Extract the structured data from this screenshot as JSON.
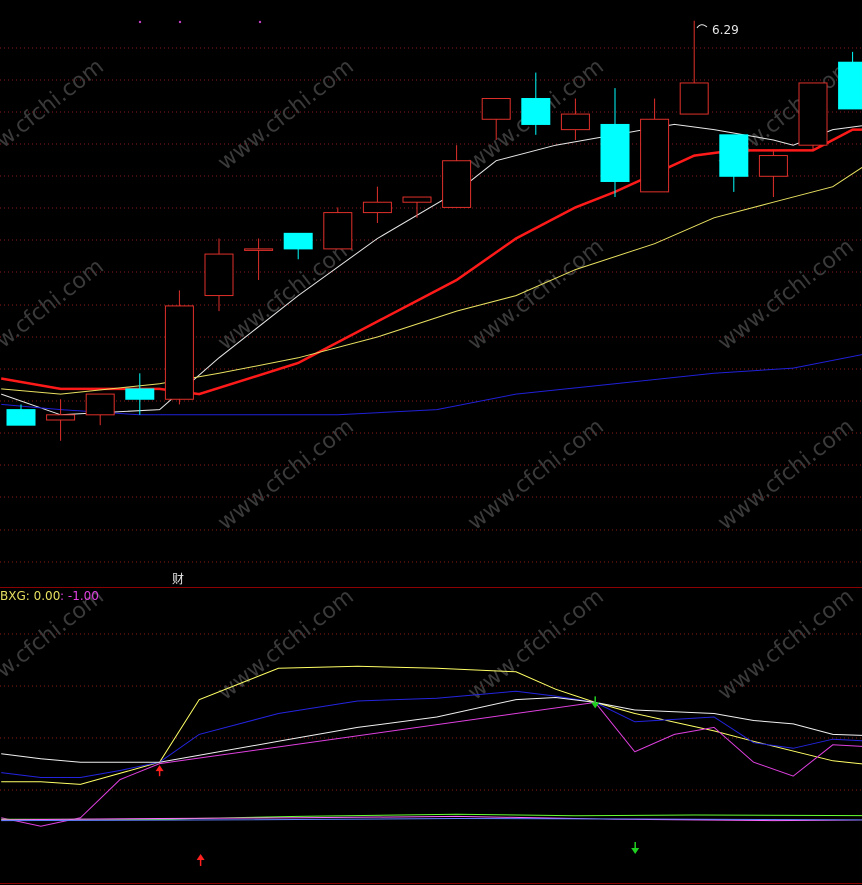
{
  "colors": {
    "background": "#000000",
    "grid": "#8b1a1a",
    "panel_border": "#8b0000",
    "up_candle": "#e0302a",
    "down_candle": "#00ffff",
    "ma_white": "#e8e8e8",
    "ma_red": "#ff1a1a",
    "ma_yellow": "#e8e060",
    "ma_blue": "#2020d8",
    "ind_yellow": "#ffff66",
    "ind_blue": "#2424e0",
    "ind_white": "#f0f0f0",
    "ind_magenta": "#e040e0",
    "ind_green": "#66ff33",
    "watermark": "#3a3a3a"
  },
  "labels": {
    "peak_price": "6.29",
    "finance_marker": "财",
    "indicator_name": "BXG: 0.00",
    "indicator_value": ": -1.00",
    "watermark": "www.cfchi.com"
  },
  "chart_data": [
    {
      "type": "candlestick",
      "ylim": [
        5.25,
        6.33
      ],
      "grid": true,
      "candles": [
        {
          "o": 5.54,
          "h": 5.55,
          "l": 5.51,
          "c": 5.51
        },
        {
          "o": 5.52,
          "h": 5.56,
          "l": 5.48,
          "c": 5.53
        },
        {
          "o": 5.53,
          "h": 5.57,
          "l": 5.51,
          "c": 5.57
        },
        {
          "o": 5.58,
          "h": 5.61,
          "l": 5.53,
          "c": 5.56
        },
        {
          "o": 5.56,
          "h": 5.77,
          "l": 5.55,
          "c": 5.74
        },
        {
          "o": 5.76,
          "h": 5.87,
          "l": 5.73,
          "c": 5.84
        },
        {
          "o": 5.85,
          "h": 5.87,
          "l": 5.79,
          "c": 5.85
        },
        {
          "o": 5.88,
          "h": 5.88,
          "l": 5.83,
          "c": 5.85
        },
        {
          "o": 5.85,
          "h": 5.93,
          "l": 5.85,
          "c": 5.92
        },
        {
          "o": 5.92,
          "h": 5.97,
          "l": 5.9,
          "c": 5.94
        },
        {
          "o": 5.94,
          "h": 5.95,
          "l": 5.91,
          "c": 5.95
        },
        {
          "o": 5.93,
          "h": 6.05,
          "l": 5.93,
          "c": 6.02
        },
        {
          "o": 6.1,
          "h": 6.11,
          "l": 6.06,
          "c": 6.14
        },
        {
          "o": 6.14,
          "h": 6.19,
          "l": 6.07,
          "c": 6.09
        },
        {
          "o": 6.08,
          "h": 6.14,
          "l": 6.06,
          "c": 6.11
        },
        {
          "o": 6.09,
          "h": 6.16,
          "l": 5.95,
          "c": 5.98
        },
        {
          "o": 5.96,
          "h": 6.14,
          "l": 5.96,
          "c": 6.1
        },
        {
          "o": 6.11,
          "h": 6.29,
          "l": 6.11,
          "c": 6.17
        },
        {
          "o": 6.07,
          "h": 6.07,
          "l": 5.96,
          "c": 5.99
        },
        {
          "o": 5.99,
          "h": 6.04,
          "l": 5.95,
          "c": 6.03
        },
        {
          "o": 6.05,
          "h": 6.16,
          "l": 6.04,
          "c": 6.17
        },
        {
          "o": 6.21,
          "h": 6.23,
          "l": 6.12,
          "c": 6.12
        }
      ],
      "series": [
        {
          "color": "#e8e8e8",
          "width": 1,
          "points": [
            [
              -0.5,
              5.57
            ],
            [
              1,
              5.53
            ],
            [
              3.5,
              5.54
            ],
            [
              5,
              5.64
            ],
            [
              7,
              5.76
            ],
            [
              9,
              5.87
            ],
            [
              11,
              5.96
            ],
            [
              12,
              6.02
            ],
            [
              13.5,
              6.05
            ],
            [
              15,
              6.07
            ],
            [
              16.5,
              6.09
            ],
            [
              17.5,
              6.08
            ],
            [
              19,
              6.06
            ],
            [
              19.5,
              6.05
            ],
            [
              20.5,
              6.08
            ],
            [
              21.5,
              6.09
            ]
          ]
        },
        {
          "color": "#ff1a1a",
          "width": 2.5,
          "points": [
            [
              -0.5,
              5.6
            ],
            [
              1,
              5.58
            ],
            [
              3.5,
              5.58
            ],
            [
              4.5,
              5.57
            ],
            [
              7,
              5.63
            ],
            [
              9,
              5.71
            ],
            [
              11,
              5.79
            ],
            [
              12.5,
              5.87
            ],
            [
              14,
              5.93
            ],
            [
              15,
              5.96
            ],
            [
              17,
              6.03
            ],
            [
              18,
              6.04
            ],
            [
              19,
              6.04
            ],
            [
              20,
              6.04
            ],
            [
              21,
              6.08
            ],
            [
              21.5,
              6.08
            ]
          ]
        },
        {
          "color": "#e8e060",
          "width": 1,
          "points": [
            [
              -0.5,
              5.58
            ],
            [
              1,
              5.57
            ],
            [
              3.5,
              5.59
            ],
            [
              5,
              5.61
            ],
            [
              7,
              5.64
            ],
            [
              9,
              5.68
            ],
            [
              11,
              5.73
            ],
            [
              12.5,
              5.76
            ],
            [
              14,
              5.81
            ],
            [
              16,
              5.86
            ],
            [
              17.5,
              5.91
            ],
            [
              19,
              5.94
            ],
            [
              20.5,
              5.97
            ],
            [
              21.5,
              6.02
            ]
          ]
        },
        {
          "color": "#2020d8",
          "width": 1,
          "points": [
            [
              -0.5,
              5.55
            ],
            [
              1,
              5.54
            ],
            [
              3,
              5.53
            ],
            [
              5,
              5.53
            ],
            [
              8,
              5.53
            ],
            [
              10.5,
              5.54
            ],
            [
              12.5,
              5.57
            ],
            [
              15,
              5.59
            ],
            [
              17.5,
              5.61
            ],
            [
              19.5,
              5.62
            ],
            [
              21.5,
              5.65
            ]
          ]
        }
      ]
    },
    {
      "type": "line",
      "ylim": [
        -1.1,
        1.1
      ],
      "grid": true,
      "signals": [
        {
          "kind": "buy",
          "x": 3.5,
          "y": -0.7
        },
        {
          "kind": "sell",
          "x": 14.5,
          "y": 0.16
        }
      ],
      "series": [
        {
          "name": "BXG",
          "color": "#ffff66",
          "points": [
            [
              -0.5,
              -0.98
            ],
            [
              0.5,
              -0.98
            ],
            [
              1.5,
              -1.02
            ],
            [
              3.5,
              -0.7
            ],
            [
              4.5,
              0.2
            ],
            [
              6.5,
              0.65
            ],
            [
              8.5,
              0.68
            ],
            [
              10.5,
              0.65
            ],
            [
              12.5,
              0.6
            ],
            [
              13.5,
              0.35
            ],
            [
              14.5,
              0.16
            ],
            [
              15.5,
              0.0
            ],
            [
              17.5,
              -0.25
            ],
            [
              18.5,
              -0.4
            ],
            [
              20.5,
              -0.68
            ],
            [
              21.5,
              -0.74
            ]
          ]
        },
        {
          "color": "#2424e0",
          "points": [
            [
              -0.5,
              -0.85
            ],
            [
              0.5,
              -0.92
            ],
            [
              1.5,
              -0.92
            ],
            [
              2.5,
              -0.82
            ],
            [
              3.5,
              -0.7
            ],
            [
              4.5,
              -0.3
            ],
            [
              6.5,
              0.0
            ],
            [
              8.5,
              0.18
            ],
            [
              10.5,
              0.22
            ],
            [
              12.5,
              0.32
            ],
            [
              13.5,
              0.25
            ],
            [
              14.5,
              0.16
            ],
            [
              15.5,
              -0.12
            ],
            [
              17.5,
              -0.05
            ],
            [
              18.5,
              -0.42
            ],
            [
              19.5,
              -0.5
            ],
            [
              20.5,
              -0.37
            ],
            [
              21.5,
              -0.4
            ]
          ]
        },
        {
          "color": "#f0f0f0",
          "points": [
            [
              -0.5,
              -0.58
            ],
            [
              0.5,
              -0.65
            ],
            [
              1.5,
              -0.7
            ],
            [
              2.5,
              -0.7
            ],
            [
              3.5,
              -0.7
            ],
            [
              4.5,
              -0.6
            ],
            [
              6.5,
              -0.4
            ],
            [
              8.5,
              -0.2
            ],
            [
              10.5,
              -0.05
            ],
            [
              12.5,
              0.2
            ],
            [
              13.5,
              0.23
            ],
            [
              14.5,
              0.16
            ],
            [
              15.5,
              0.05
            ],
            [
              17.5,
              0.0
            ],
            [
              18.5,
              -0.1
            ],
            [
              19.5,
              -0.15
            ],
            [
              20.5,
              -0.3
            ],
            [
              21.5,
              -0.32
            ]
          ]
        },
        {
          "color": "#e040e0",
          "points": [
            [
              -0.5,
              -1.5
            ],
            [
              0.5,
              -1.62
            ],
            [
              1.5,
              -1.5
            ],
            [
              2.5,
              -0.95
            ],
            [
              3.5,
              -0.72
            ],
            [
              14.5,
              0.16
            ],
            [
              15.5,
              -0.55
            ],
            [
              16.5,
              -0.3
            ],
            [
              17.5,
              -0.2
            ],
            [
              18.5,
              -0.7
            ],
            [
              19.5,
              -0.9
            ],
            [
              20.5,
              -0.45
            ],
            [
              21.5,
              -0.48
            ]
          ]
        },
        {
          "color": "#66ff33",
          "points": [
            [
              -0.5,
              -1.52
            ],
            [
              3.5,
              -1.52
            ],
            [
              7,
              -1.48
            ],
            [
              11,
              -1.45
            ],
            [
              14,
              -1.47
            ],
            [
              17,
              -1.46
            ],
            [
              21.5,
              -1.47
            ]
          ]
        },
        {
          "color": "#ff66ff",
          "points": [
            [
              -0.5,
              -1.53
            ],
            [
              3.5,
              -1.51
            ],
            [
              7,
              -1.5
            ],
            [
              11,
              -1.48
            ],
            [
              15,
              -1.52
            ],
            [
              19,
              -1.54
            ],
            [
              21.5,
              -1.53
            ]
          ]
        },
        {
          "color": "#6080ff",
          "points": [
            [
              -0.5,
              -1.54
            ],
            [
              5,
              -1.53
            ],
            [
              11,
              -1.51
            ],
            [
              17,
              -1.52
            ],
            [
              21.5,
              -1.53
            ]
          ]
        }
      ]
    }
  ]
}
